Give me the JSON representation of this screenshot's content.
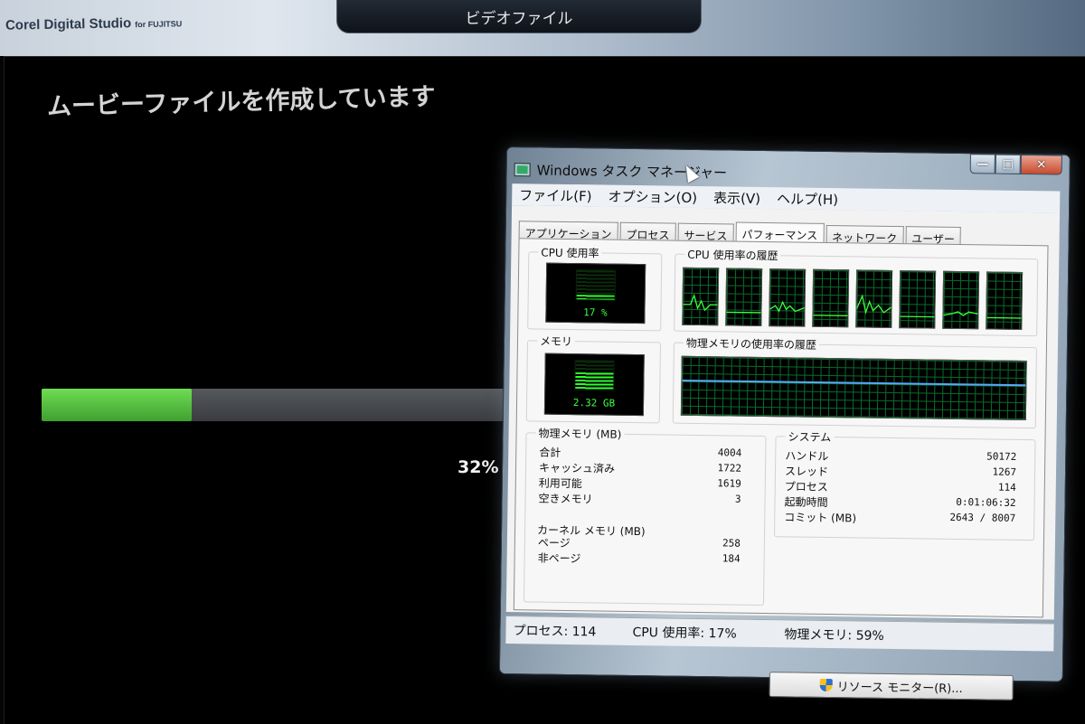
{
  "app": {
    "brand": "Corel Digital Studio",
    "brand_suffix": "for FUJITSU",
    "top_tab": "ビデオファイル",
    "title": "ムービーファイルを作成しています",
    "progress": {
      "value": 0.32,
      "label": "32%"
    }
  },
  "taskmgr": {
    "title": "Windows タスク マネージャー",
    "window_buttons": {
      "minimize": "—",
      "maximize": "□",
      "close": "✕"
    },
    "menu": [
      "ファイル(F)",
      "オプション(O)",
      "表示(V)",
      "ヘルプ(H)"
    ],
    "tabs": [
      "アプリケーション",
      "プロセス",
      "サービス",
      "パフォーマンス",
      "ネットワーク",
      "ユーザー"
    ],
    "active_tab": "パフォーマンス",
    "cpu_usage": {
      "label": "CPU 使用率",
      "value_text": "17 %",
      "fraction": 0.17
    },
    "cpu_history": {
      "label": "CPU 使用率の履歴",
      "cores": 8
    },
    "memory": {
      "label": "メモリ",
      "value_text": "2.32 GB",
      "fraction": 0.59
    },
    "memory_history": {
      "label": "物理メモリの使用率の履歴"
    },
    "physical_memory": {
      "label": "物理メモリ (MB)",
      "rows": [
        {
          "name": "合計",
          "value": "4004"
        },
        {
          "name": "キャッシュ済み",
          "value": "1722"
        },
        {
          "name": "利用可能",
          "value": "1619"
        },
        {
          "name": "空きメモリ",
          "value": "3"
        }
      ]
    },
    "kernel_memory": {
      "label": "カーネル メモリ (MB)",
      "rows": [
        {
          "name": "ページ",
          "value": "258"
        },
        {
          "name": "非ページ",
          "value": "184"
        }
      ]
    },
    "system": {
      "label": "システム",
      "rows": [
        {
          "name": "ハンドル",
          "value": "50172"
        },
        {
          "name": "スレッド",
          "value": "1267"
        },
        {
          "name": "プロセス",
          "value": "114"
        },
        {
          "name": "起動時間",
          "value": "0:01:06:32"
        },
        {
          "name": "コミット (MB)",
          "value": "2643 / 8007"
        }
      ]
    },
    "resource_monitor_button": "リソース モニター(R)...",
    "status": {
      "processes": "プロセス: 114",
      "cpu": "CPU 使用率: 17%",
      "memory": "物理メモリ: 59%"
    },
    "colors": {
      "graph_green": "#3cff3c",
      "grid": "#0a6b2c",
      "mem_line": "#5aa8ff"
    }
  }
}
